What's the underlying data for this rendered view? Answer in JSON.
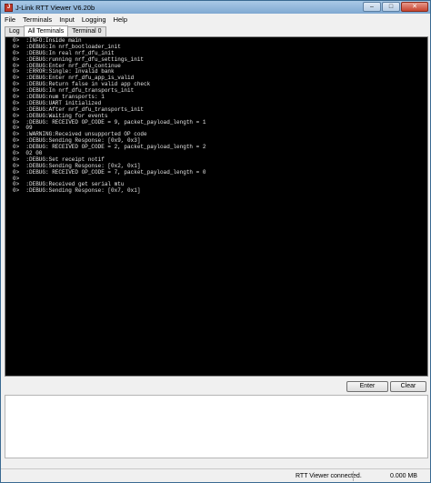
{
  "window": {
    "title": "J-Link RTT Viewer V6.20b"
  },
  "menu": [
    "File",
    "Terminals",
    "Input",
    "Logging",
    "Help"
  ],
  "tabs": [
    "Log",
    "All Terminals",
    "Terminal 0"
  ],
  "active_tab": "All Terminals",
  "terminal_lines": [
    "0>  :INFO:Inside main",
    "0>  :DEBUG:In nrf_bootloader_init",
    "0>  :DEBUG:In real nrf_dfu_init",
    "0>  :DEBUG:running nrf_dfu_settings_init",
    "0>  :DEBUG:Enter nrf_dfu_continue",
    "0>  :ERROR:Single: Invalid bank",
    "0>  :DEBUG:Enter nrf_dfu_app_is_valid",
    "0>  :DEBUG:Return false in valid app check",
    "0>  :DEBUG:In nrf_dfu_transports_init",
    "0>  :DEBUG:num transports: 1",
    "0>  :DEBUG:UART initialized",
    "0>  :DEBUG:After nrf_dfu_transports_init",
    "0>  :DEBUG:Waiting for events",
    "0>  :DEBUG: RECEIVED OP_CODE = 9, packet_payload_length = 1",
    "0>  09",
    "0>  :WARNING:Received unsupported OP code",
    "0>  :DEBUG:Sending Response: [0x9, 0x3]",
    "0>  :DEBUG: RECEIVED OP_CODE = 2, packet_payload_length = 2",
    "0>  02 00",
    "0>  :DEBUG:Set receipt notif",
    "0>  :DEBUG:Sending Response: [0x2, 0x1]",
    "0>  :DEBUG: RECEIVED OP_CODE = 7, packet_payload_length = 0",
    "0>",
    "0>  :DEBUG:Received get serial mtu",
    "0>  :DEBUG:Sending Response: [0x7, 0x1]"
  ],
  "buttons": {
    "enter": "Enter",
    "clear": "Clear"
  },
  "input": {
    "value": ""
  },
  "status": {
    "connection": "RTT Viewer connected.",
    "data_size": "0.000 MB"
  },
  "icons": {
    "app": "jlink-app-icon",
    "minimize": "minimize-icon",
    "maximize": "maximize-icon",
    "close": "close-icon"
  }
}
